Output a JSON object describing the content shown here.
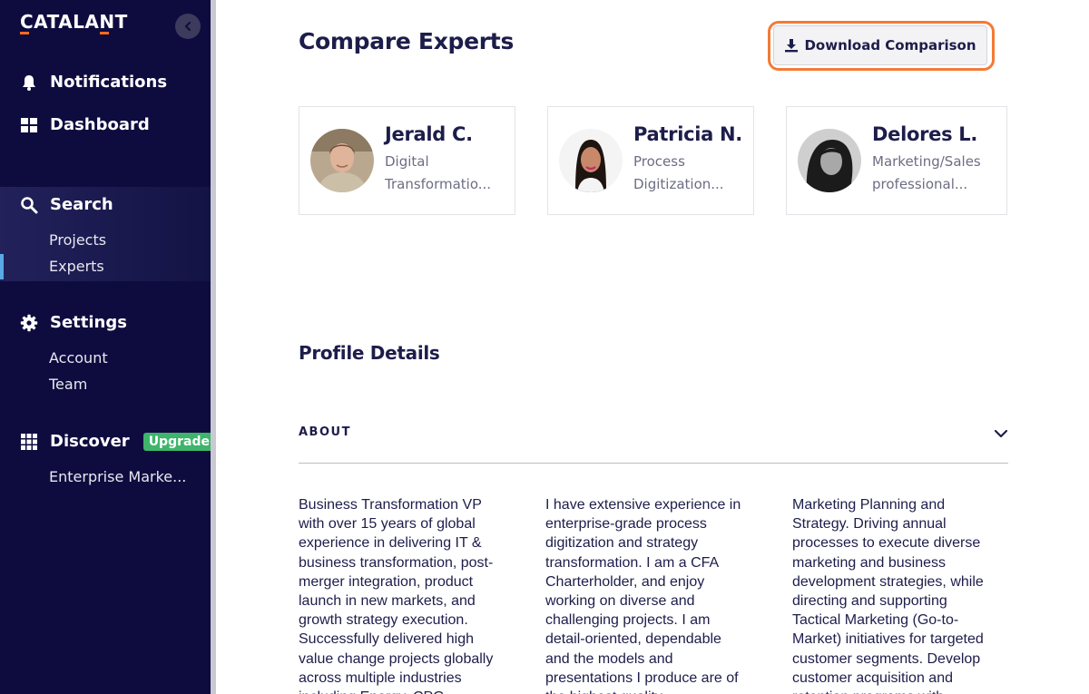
{
  "brand": {
    "logo_text": "CATALANT",
    "accent": "#f26b21"
  },
  "sidebar": {
    "collapse_icon": "chevron-left-icon",
    "notifications": {
      "label": "Notifications",
      "icon": "bell-icon"
    },
    "dashboard": {
      "label": "Dashboard",
      "icon": "grid-icon"
    },
    "search": {
      "label": "Search",
      "icon": "search-icon",
      "items": [
        {
          "label": "Projects"
        },
        {
          "label": "Experts",
          "active": true
        }
      ]
    },
    "settings": {
      "label": "Settings",
      "icon": "gear-icon",
      "items": [
        {
          "label": "Account"
        },
        {
          "label": "Team"
        }
      ]
    },
    "discover": {
      "label": "Discover",
      "icon": "apps-icon",
      "badge": "Upgrade",
      "items": [
        {
          "label": "Enterprise Marke..."
        }
      ]
    }
  },
  "main": {
    "title": "Compare Experts",
    "download_button": {
      "label": "Download Comparison",
      "icon": "download-icon"
    },
    "experts": [
      {
        "name": "Jerald C.",
        "role_lines": [
          "Digital",
          "Transformatio..."
        ]
      },
      {
        "name": "Patricia N.",
        "role_lines": [
          "Process",
          "Digitization..."
        ]
      },
      {
        "name": "Delores L.",
        "role_lines": [
          "Marketing/Sales",
          "professional..."
        ]
      }
    ],
    "profile_details_title": "Profile Details",
    "about": {
      "header": "ABOUT",
      "expanded_icon": "chevron-down-icon",
      "columns": [
        [
          "Business Transformation VP",
          "with over 15 years of global",
          "experience in delivering IT &",
          "business transformation, post-",
          "merger integration, product",
          "launch in new markets, and",
          "growth strategy execution.",
          "Successfully delivered high",
          "value change projects globally",
          "across multiple industries",
          "including Energy, CPG,"
        ],
        [
          "I have extensive experience in",
          "enterprise-grade process",
          "digitization and strategy",
          "transformation. I am a CFA",
          "Charterholder, and enjoy",
          "working on diverse and",
          "challenging projects. I am",
          "detail-oriented, dependable",
          "and the models and",
          "presentations I produce are of",
          "the highest quality."
        ],
        [
          "Marketing Planning and",
          "Strategy. Driving annual",
          "processes to execute diverse",
          "marketing and business",
          "development strategies, while",
          "directing and supporting",
          "Tactical Marketing (Go-to-",
          "Market) initiatives for targeted",
          "customer segments. Develop",
          "customer acquisition and",
          "retention programs with"
        ]
      ]
    }
  }
}
